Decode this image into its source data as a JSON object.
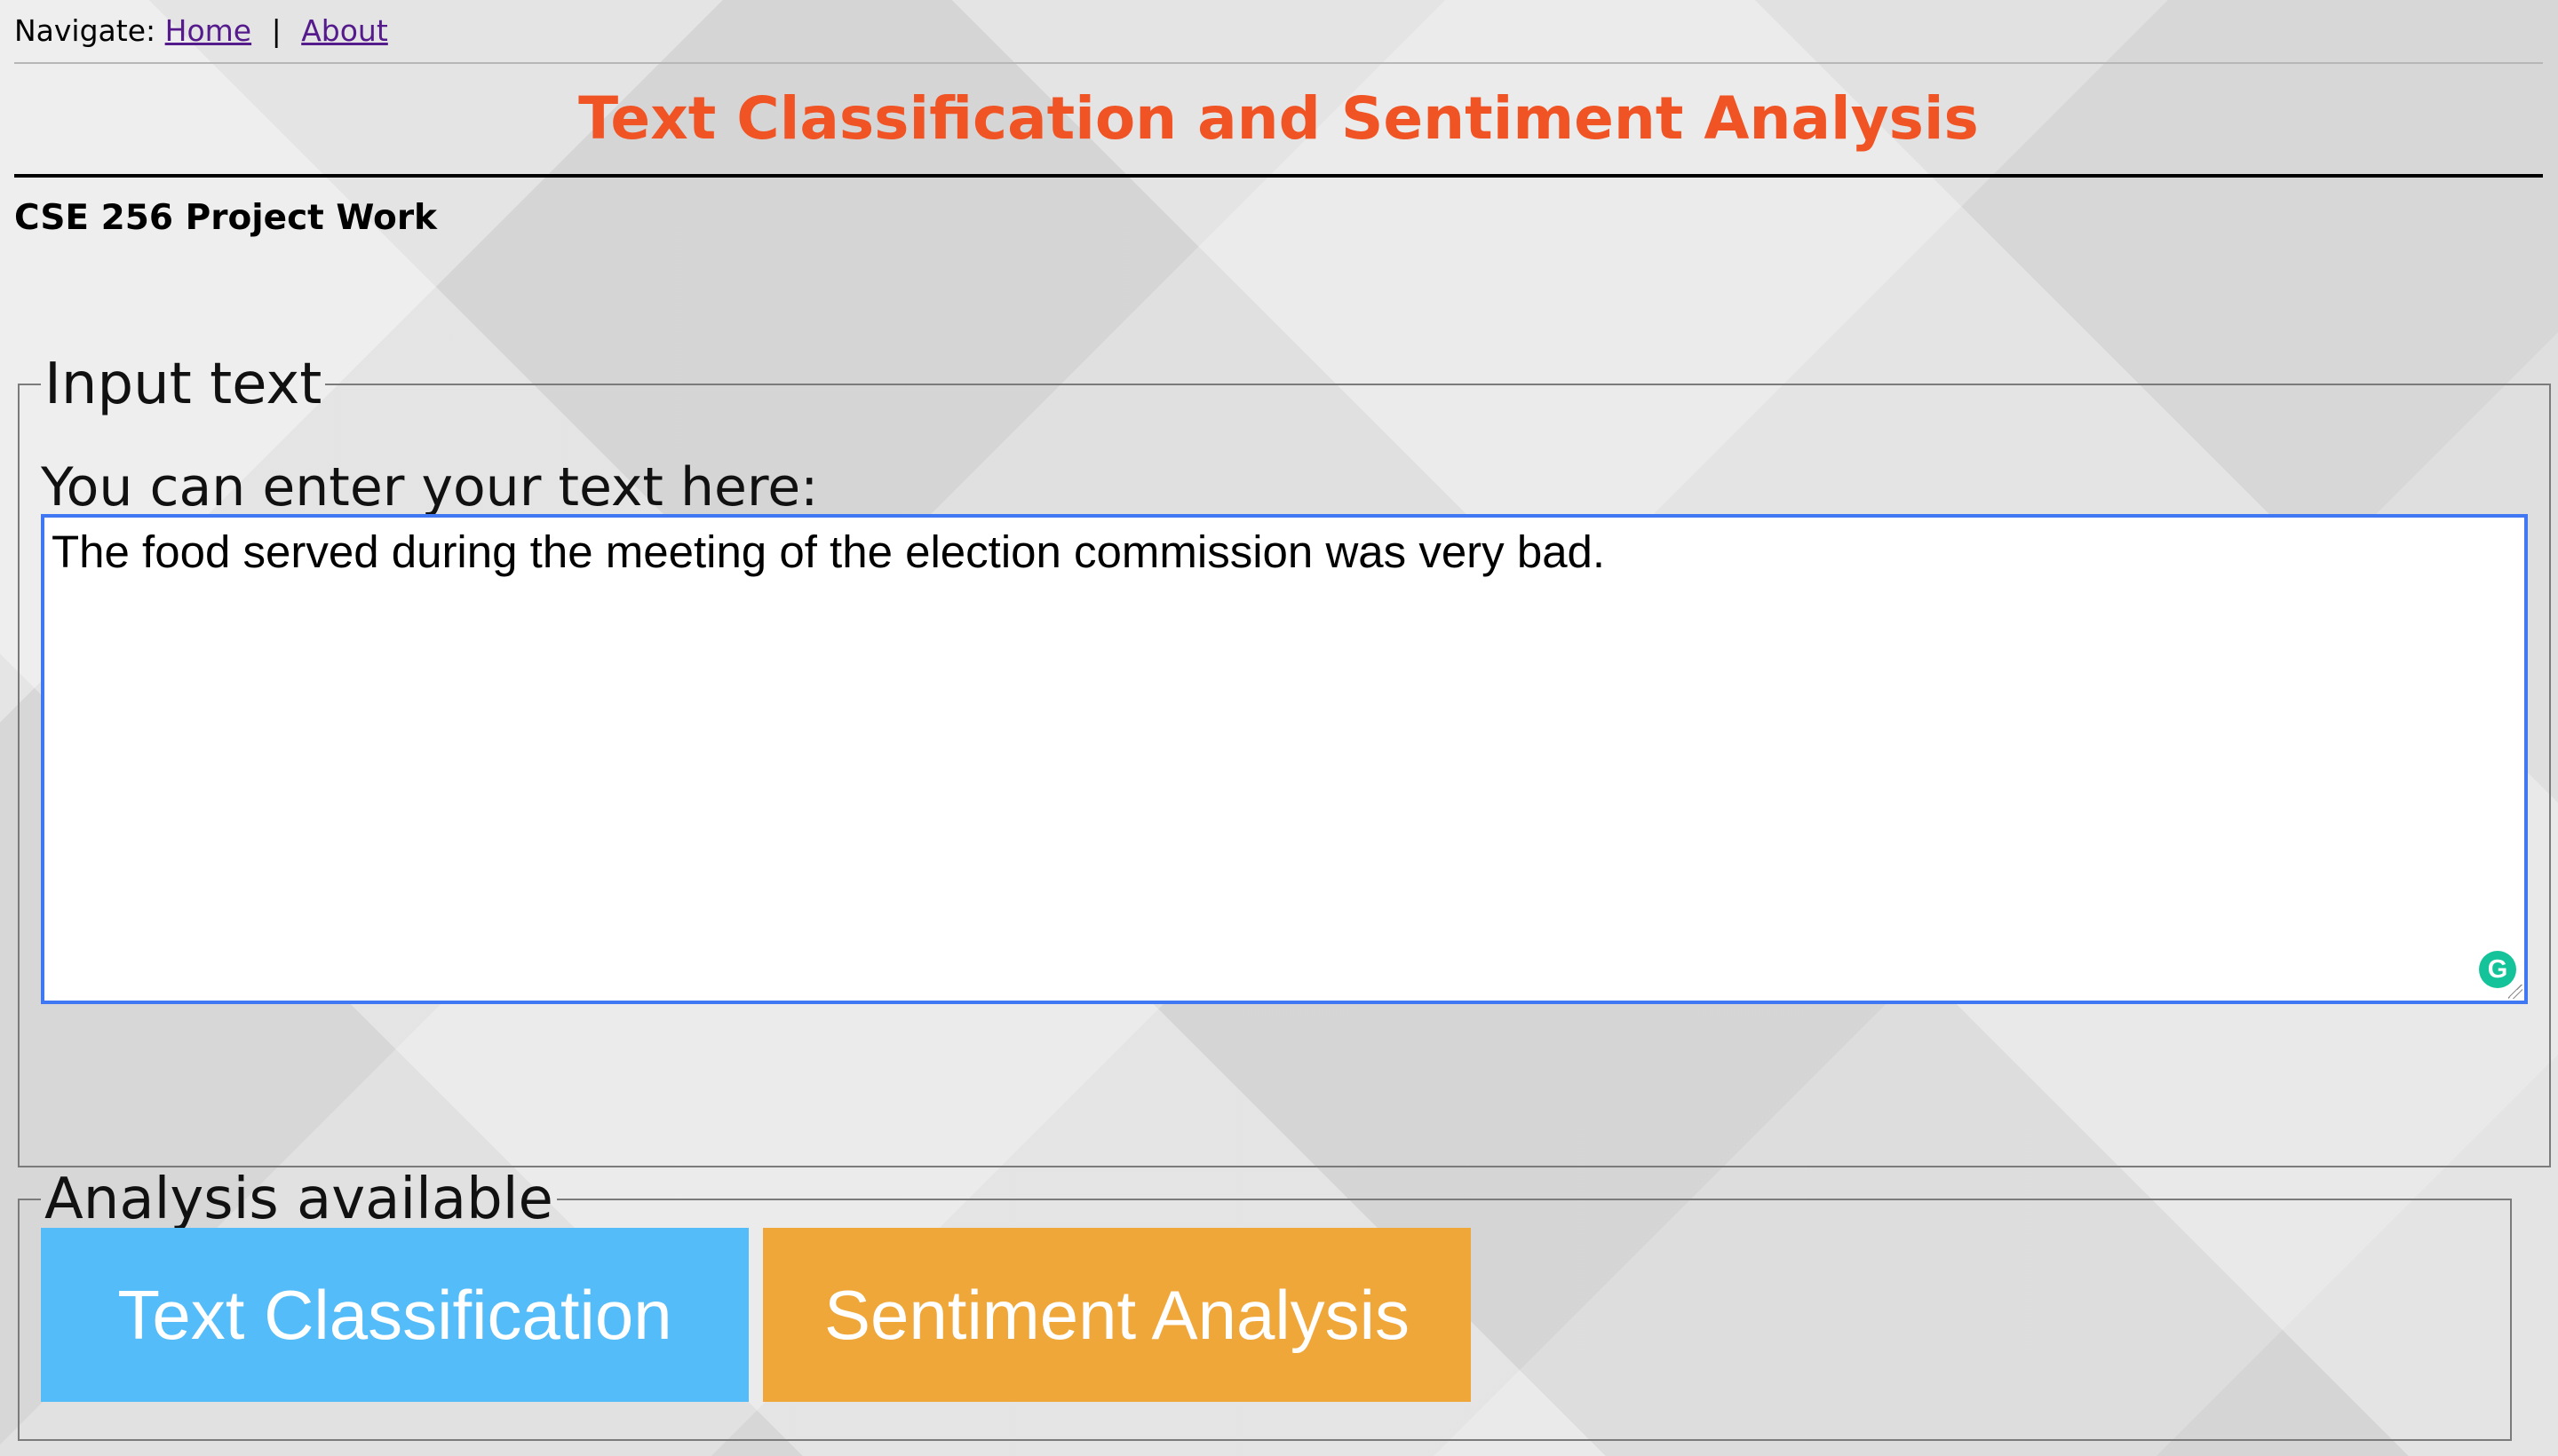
{
  "navigation": {
    "label": "Navigate:",
    "separator": "|",
    "links": [
      {
        "label": "Home"
      },
      {
        "label": "About"
      }
    ]
  },
  "page": {
    "title": "Text Classification and Sentiment Analysis",
    "subtitle": "CSE 256 Project Work"
  },
  "input_section": {
    "legend": "Input text",
    "prompt": "You can enter your text here:",
    "text_value": "The food served during the meeting of the election commission was very bad.",
    "grammar_icon": "G"
  },
  "analysis_section": {
    "legend": "Analysis available",
    "buttons": [
      {
        "label": "Text Classification",
        "color": "#54BCF8"
      },
      {
        "label": "Sentiment Analysis",
        "color": "#F0A73A"
      }
    ]
  },
  "colors": {
    "title": "#F05324",
    "link": "#551A8B",
    "focus_border": "#3F78F2",
    "grammar_icon": "#15C39A"
  },
  "icons": {
    "grammar": "grammar-assistant-icon",
    "resize": "resize-handle-icon"
  }
}
